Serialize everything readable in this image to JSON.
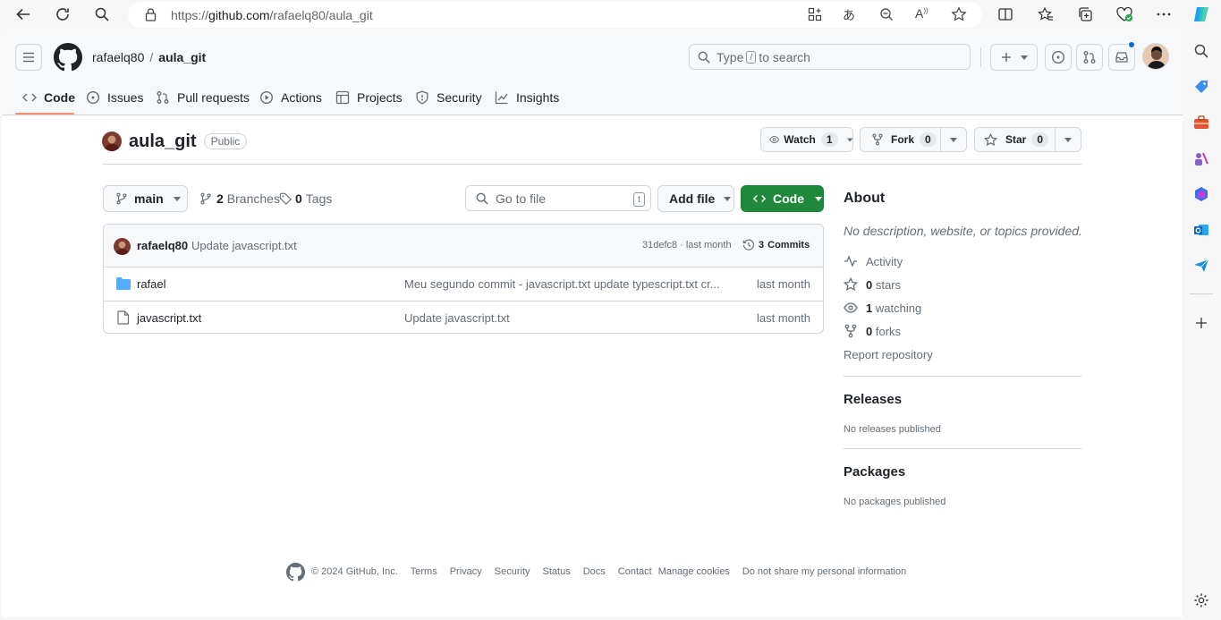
{
  "browser": {
    "url": "https://github.com/rafaelq80/aula_git",
    "url_scheme": "https://",
    "url_host": "github.com",
    "url_path": "/rafaelq80/aula_git"
  },
  "header": {
    "owner": "rafaelq80",
    "separator": "/",
    "repo": "aula_git",
    "search": {
      "prefix": "Type",
      "key": "/",
      "suffix": "to search"
    }
  },
  "tabs": [
    {
      "label": "Code",
      "icon": "code-icon",
      "active": true
    },
    {
      "label": "Issues",
      "icon": "issue-icon"
    },
    {
      "label": "Pull requests",
      "icon": "pull-request-icon"
    },
    {
      "label": "Actions",
      "icon": "play-icon"
    },
    {
      "label": "Projects",
      "icon": "table-icon"
    },
    {
      "label": "Security",
      "icon": "shield-icon"
    },
    {
      "label": "Insights",
      "icon": "graph-icon"
    }
  ],
  "repo": {
    "name": "aula_git",
    "visibility": "Public",
    "watch": {
      "label": "Watch",
      "count": "1"
    },
    "fork": {
      "label": "Fork",
      "count": "0"
    },
    "star": {
      "label": "Star",
      "count": "0"
    }
  },
  "toolbar": {
    "branch": "main",
    "branches_count": "2",
    "branches_label": "Branches",
    "tags_count": "0",
    "tags_label": "Tags",
    "goto_placeholder": "Go to file",
    "goto_key": "t",
    "add_file": "Add file",
    "code": "Code"
  },
  "latest_commit": {
    "author": "rafaelq80",
    "message": "Update javascript.txt",
    "hash": "31defc8",
    "separator": "·",
    "time": "last month",
    "commits_count": "3",
    "commits_label": "Commits"
  },
  "files": [
    {
      "name": "rafael",
      "type": "folder",
      "message": "Meu segundo commit - javascript.txt update typescript.txt cr...",
      "time": "last month"
    },
    {
      "name": "javascript.txt",
      "type": "file",
      "message": "Update javascript.txt",
      "time": "last month"
    }
  ],
  "about": {
    "title": "About",
    "description": "No description, website, or topics provided.",
    "activity": "Activity",
    "stars_count": "0",
    "stars_label": "stars",
    "watching_count": "1",
    "watching_label": "watching",
    "forks_count": "0",
    "forks_label": "forks",
    "report": "Report repository"
  },
  "releases": {
    "title": "Releases",
    "text": "No releases published"
  },
  "packages": {
    "title": "Packages",
    "text": "No packages published"
  },
  "footer": {
    "copyright": "© 2024 GitHub, Inc.",
    "links": [
      "Terms",
      "Privacy",
      "Security",
      "Status",
      "Docs",
      "Contact",
      "Manage cookies",
      "Do not share my personal information"
    ]
  },
  "colors": {
    "accent_green": "#1f883d",
    "tab_underline": "#fd8c73",
    "folder_blue": "#54aeff",
    "notification_dot": "#0969da"
  }
}
